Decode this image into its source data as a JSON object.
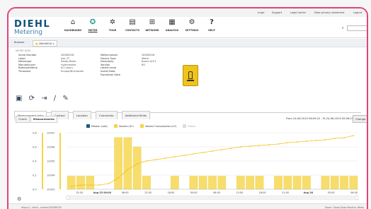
{
  "topbar": {
    "user": "mrge",
    "support": "Support",
    "legal": "Legal notice",
    "privacy": "Data privacy statement",
    "logout": "Logout"
  },
  "logo": {
    "top": "DIEHL",
    "bottom": "Metering"
  },
  "nav": [
    {
      "label": "DASHBOARD",
      "icon": "home-icon",
      "glyph": "⌂"
    },
    {
      "label": "METER",
      "icon": "meter-icon",
      "glyph": "✪"
    },
    {
      "label": "TOUR",
      "icon": "tour-icon",
      "glyph": "✲"
    },
    {
      "label": "CONTACTS",
      "icon": "contacts-icon",
      "glyph": "▤"
    },
    {
      "label": "NETWORK",
      "icon": "network-icon",
      "glyph": "⊞"
    },
    {
      "label": "ANALYSIS",
      "icon": "analysis-icon",
      "glyph": "▦"
    },
    {
      "label": "SETTINGS",
      "icon": "settings-icon",
      "glyph": "⚙"
    },
    {
      "label": "HELP",
      "icon": "help-icon",
      "glyph": "?"
    }
  ],
  "breadcrumb": {
    "browser": "Browser",
    "tab": "26506526"
  },
  "info_title": "METER DATA",
  "info": {
    "col1_labels": [
      "Serial Number",
      "Label",
      "Metertype",
      "Manufacturer",
      "Batterylifetime",
      "Timezone"
    ],
    "col1_values": [
      "26506526",
      "Izar 2T",
      "Radio Meter",
      "Hydrometer",
      "6.0 years",
      "Europe/Bucharest"
    ],
    "col2_labels": [
      "Meternumber",
      "Device Type",
      "Devicekey",
      "Version",
      "Latest value",
      "Install Date",
      "Expiration Date"
    ],
    "col2_values": [
      "26506526",
      "Meter",
      "Bosen 6/13",
      "B0",
      "",
      "",
      ""
    ]
  },
  "tabs": [
    "Measurement data",
    "Contact",
    "Location",
    "Comments",
    "Additional fields"
  ],
  "subtabs": [
    "Charts",
    "Measurements"
  ],
  "range": "From 24-06-2019 08:09:22 - To 24-06-2019 05:06:23",
  "change_button": "Change",
  "legend": [
    {
      "label": "Mission (volt)",
      "color": "#1c5a77"
    },
    {
      "label": "Volume (m³)",
      "color": "#f5d34a"
    },
    {
      "label": "Volume Consumption (m³)",
      "color": "#f5d34a"
    },
    {
      "label": "Status",
      "color": "#cccccc"
    }
  ],
  "bottom": {
    "url": "https://...diehl.../meter/26506526",
    "zoom": "Zoom: Show Data Months: Week"
  },
  "chart_data": {
    "type": "bar",
    "categories": [
      "",
      "",
      "",
      "",
      "",
      "",
      "",
      "",
      "",
      "",
      "",
      "",
      "",
      "",
      "",
      "",
      "",
      "",
      "",
      "",
      "",
      "",
      "",
      "",
      "",
      "",
      "",
      "",
      "",
      "",
      ""
    ],
    "x_tick_labels": [
      "12:00",
      "Aug 25 00:00",
      "06:00",
      "12:00",
      "18:00",
      "00:00",
      "06:00",
      "12:00",
      "18:00",
      "21:00",
      "Aug 26",
      "03:00",
      "06:00"
    ],
    "y_left_ticks": [
      "0.8",
      "0.6",
      "0.4",
      "0.2",
      "0.0"
    ],
    "y_right_ticks": [
      "10097",
      "10096",
      "10095",
      "10094",
      "10093"
    ],
    "series": [
      {
        "name": "Volume Consumption (m³)",
        "values": [
          0.28,
          0.28,
          0.28,
          0,
          0,
          1.1,
          1.1,
          0.9,
          0.28,
          0,
          0,
          0.28,
          0,
          0.28,
          0.28,
          0.28,
          0.28,
          0,
          0.28,
          0.28,
          0.28,
          0,
          0.28,
          0.28,
          0.28,
          0.28,
          0,
          0.28,
          0.28,
          0.28,
          0.28
        ]
      },
      {
        "name": "Volume (m³)",
        "values": [
          10093.2,
          10093.3,
          10093.3,
          10093.3,
          10093.4,
          10093.8,
          10094.4,
          10094.8,
          10095.0,
          10095.1,
          10095.2,
          10095.3,
          10095.4,
          10095.5,
          10095.6,
          10095.7,
          10095.8,
          10095.9,
          10096.0,
          10096.05,
          10096.1,
          10096.15,
          10096.2,
          10096.3,
          10096.35,
          10096.4,
          10096.45,
          10096.5,
          10096.6,
          10096.65,
          10096.8
        ]
      }
    ],
    "ylim_left": [
      0,
      1.2
    ],
    "ylim_right": [
      10093,
      10097
    ]
  }
}
